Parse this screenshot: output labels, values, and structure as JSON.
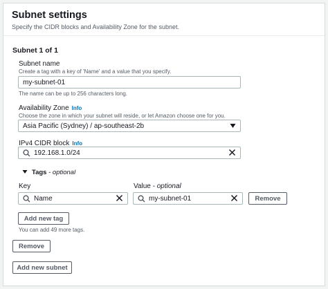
{
  "header": {
    "title": "Subnet settings",
    "description": "Specify the CIDR blocks and Availability Zone for the subnet."
  },
  "subnet": {
    "title": "Subnet 1 of 1",
    "name": {
      "label": "Subnet name",
      "description": "Create a tag with a key of 'Name' and a value that you specify.",
      "value": "my-subnet-01",
      "constraint": "The name can be up to 256 characters long."
    },
    "az": {
      "label": "Availability Zone",
      "info": "Info",
      "description": "Choose the zone in which your subnet will reside, or let Amazon choose one for you.",
      "selected": "Asia Pacific (Sydney) / ap-southeast-2b"
    },
    "cidr": {
      "label": "IPv4 CIDR block",
      "info": "Info",
      "value": "192.168.1.0/24"
    },
    "tags": {
      "toggle_label": "Tags",
      "toggle_optional": "- optional",
      "key_label": "Key",
      "value_label": "Value",
      "value_optional": "- optional",
      "rows": [
        {
          "key": "Name",
          "value": "my-subnet-01",
          "remove_label": "Remove"
        }
      ],
      "add_label": "Add new tag",
      "limit_note": "You can add 49 more tags."
    },
    "remove_label": "Remove"
  },
  "add_subnet_label": "Add new subnet",
  "colors": {
    "link": "#0073bb",
    "border": "#aab7b8",
    "text": "#16191f",
    "muted": "#545b64"
  },
  "icons": [
    "search-icon",
    "clear-icon",
    "caret-down-icon",
    "caret-down-toggle-icon"
  ]
}
